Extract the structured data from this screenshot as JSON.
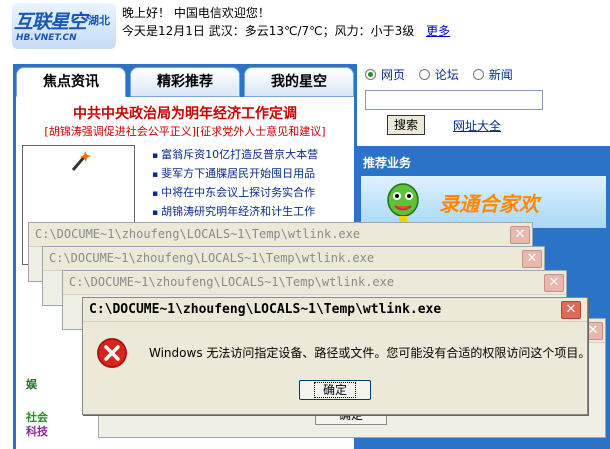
{
  "header": {
    "logo_text": "互联星空",
    "logo_region": "湖北",
    "logo_url": "HB.VNET.CN",
    "greeting": "晚上好！  中国电信欢迎您！",
    "weather": "今天是12月1日  武汉：多云13℃/7℃；风力：小于3级",
    "more_link": "更多"
  },
  "tabs": [
    {
      "label": "焦点资讯",
      "active": true
    },
    {
      "label": "精彩推荐",
      "active": false
    },
    {
      "label": "我的星空",
      "active": false
    }
  ],
  "news": {
    "headline": "中共中央政治局为明年经济工作定调",
    "subline": "[胡锦涛强调促进社会公平正义][征求党外人士意见和建议]",
    "items": [
      "富翁斥资10亿打造反普京大本营",
      "斐军方下通牒居民开始囤日用品",
      "中将在中东会议上探讨务实合作",
      "胡锦涛研究明年经济和计生工作"
    ],
    "left_fragments": [
      "娱",
      "社会",
      "科技"
    ]
  },
  "search": {
    "options": [
      {
        "label": "网页",
        "selected": true
      },
      {
        "label": "论坛",
        "selected": false
      },
      {
        "label": "新闻",
        "selected": false
      }
    ],
    "button": "搜索",
    "link": "网址大全"
  },
  "recommend": {
    "title": "推荐业务",
    "banner_text": "录通合家欢"
  },
  "dialogs": {
    "title": "C:\\DOCUME~1\\zhoufeng\\LOCALS~1\\Temp\\wtlink.exe",
    "close_glyph": "✕",
    "message": "Windows 无法访问指定设备、路径或文件。您可能没有合适的权限访问这个项目。",
    "ok_label": "确定"
  },
  "colors": {
    "brand_blue": "#2b73c7",
    "headline_red": "#cc0000",
    "error_red": "#cc1a1a",
    "dialog_bg": "#ece9d8"
  }
}
